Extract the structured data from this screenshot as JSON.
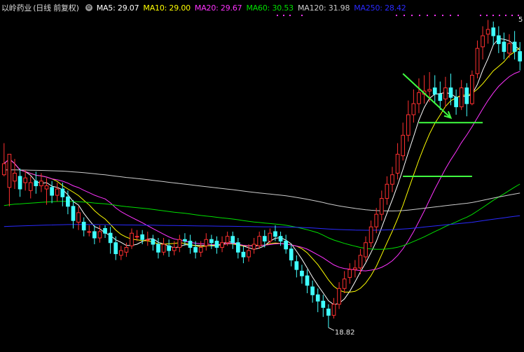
{
  "header": {
    "stock_name": "以岭药业",
    "period": "(日线 前复权)",
    "settings_icon": "settings-icon"
  },
  "ma_legend": [
    {
      "label": "MA5: 29.07",
      "color": "#ffffff"
    },
    {
      "label": "MA10: 29.00",
      "color": "#ffff00"
    },
    {
      "label": "MA20: 29.67",
      "color": "#ff33ff"
    },
    {
      "label": "MA60: 30.53",
      "color": "#00e000"
    },
    {
      "label": "MA120: 31.98",
      "color": "#cccccc"
    },
    {
      "label": "MA250: 28.42",
      "color": "#2a2aff"
    }
  ],
  "annotations": {
    "low_label": "18.82",
    "high_label": "5"
  },
  "chart_data": {
    "type": "candlestick",
    "title": "以岭药业 (日线 前复权)",
    "ylim": [
      17.5,
      38.5
    ],
    "low_value": 18.82,
    "grid": false,
    "up_color": "#ff3030",
    "down_color": "#40ffff",
    "candles": [
      [
        28.5,
        29.2,
        28.4,
        30.5
      ],
      [
        27.7,
        29.8,
        26.5,
        28.9
      ],
      [
        28.1,
        28.6,
        27.6,
        29.5
      ],
      [
        28.4,
        27.6,
        27.1,
        28.9
      ],
      [
        28.0,
        28.3,
        27.5,
        28.8
      ],
      [
        27.5,
        28.0,
        27.0,
        28.4
      ],
      [
        28.1,
        27.8,
        27.3,
        28.7
      ],
      [
        27.8,
        28.1,
        27.4,
        28.6
      ],
      [
        27.6,
        27.8,
        26.6,
        28.3
      ],
      [
        27.7,
        27.2,
        26.7,
        28.1
      ],
      [
        27.2,
        27.6,
        26.8,
        28.0
      ],
      [
        27.6,
        27.1,
        26.5,
        28.0
      ],
      [
        27.1,
        26.5,
        26.0,
        27.5
      ],
      [
        26.5,
        25.6,
        25.1,
        26.9
      ],
      [
        25.5,
        26.1,
        25.0,
        26.5
      ],
      [
        25.5,
        25.0,
        24.6,
        25.8
      ],
      [
        24.9,
        24.9,
        24.6,
        25.3
      ],
      [
        24.9,
        24.5,
        24.1,
        25.3
      ],
      [
        24.5,
        24.9,
        24.2,
        25.3
      ],
      [
        25.1,
        24.8,
        24.5,
        25.3
      ],
      [
        24.8,
        24.2,
        23.5,
        25.2
      ],
      [
        24.2,
        23.5,
        23.1,
        24.6
      ],
      [
        23.4,
        23.7,
        23.1,
        24.0
      ],
      [
        23.6,
        23.9,
        23.3,
        24.2
      ],
      [
        24.0,
        24.8,
        23.8,
        25.1
      ],
      [
        24.6,
        24.6,
        24.3,
        25.0
      ],
      [
        24.7,
        24.4,
        24.1,
        25.0
      ],
      [
        24.4,
        24.4,
        24.0,
        24.9
      ],
      [
        24.4,
        24.1,
        23.7,
        24.7
      ],
      [
        24.1,
        23.6,
        23.2,
        24.5
      ],
      [
        23.6,
        24.1,
        23.4,
        24.5
      ],
      [
        24.0,
        23.7,
        23.3,
        24.4
      ],
      [
        23.7,
        23.9,
        23.4,
        24.3
      ],
      [
        23.9,
        24.4,
        23.6,
        24.7
      ],
      [
        24.4,
        24.3,
        24.0,
        24.8
      ],
      [
        24.3,
        23.9,
        23.5,
        24.7
      ],
      [
        23.9,
        23.6,
        23.2,
        24.3
      ],
      [
        23.6,
        23.9,
        23.3,
        24.3
      ],
      [
        24.0,
        24.4,
        23.7,
        24.8
      ],
      [
        24.4,
        24.2,
        23.8,
        24.7
      ],
      [
        24.3,
        23.9,
        23.5,
        24.6
      ],
      [
        23.9,
        24.2,
        23.6,
        24.6
      ],
      [
        24.2,
        24.6,
        24.0,
        24.9
      ],
      [
        24.6,
        24.2,
        23.8,
        24.9
      ],
      [
        24.2,
        23.6,
        23.2,
        24.5
      ],
      [
        23.6,
        23.3,
        22.9,
        24.0
      ],
      [
        23.3,
        23.7,
        23.0,
        24.1
      ],
      [
        23.8,
        24.1,
        23.5,
        24.5
      ],
      [
        24.0,
        24.6,
        23.8,
        24.9
      ],
      [
        24.6,
        24.3,
        23.9,
        25.0
      ],
      [
        24.3,
        24.8,
        24.1,
        25.1
      ],
      [
        24.9,
        24.6,
        24.3,
        25.3
      ],
      [
        24.6,
        24.3,
        24.0,
        24.9
      ],
      [
        24.3,
        23.8,
        23.5,
        24.7
      ],
      [
        23.8,
        23.1,
        22.7,
        24.1
      ],
      [
        23.0,
        22.5,
        22.0,
        23.4
      ],
      [
        22.4,
        22.1,
        21.6,
        22.8
      ],
      [
        22.1,
        21.5,
        21.0,
        22.5
      ],
      [
        21.4,
        20.9,
        20.4,
        21.8
      ],
      [
        20.9,
        20.5,
        19.8,
        21.3
      ],
      [
        20.5,
        20.1,
        19.5,
        20.9
      ],
      [
        20.0,
        19.6,
        18.82,
        20.3
      ],
      [
        19.6,
        20.3,
        19.4,
        20.7
      ],
      [
        20.3,
        21.3,
        20.0,
        21.7
      ],
      [
        21.3,
        21.9,
        21.0,
        22.4
      ],
      [
        22.0,
        22.5,
        21.6,
        22.9
      ],
      [
        22.5,
        22.6,
        22.0,
        23.1
      ],
      [
        22.6,
        23.4,
        22.2,
        23.8
      ],
      [
        23.3,
        24.2,
        23.0,
        24.6
      ],
      [
        24.2,
        25.2,
        23.9,
        25.6
      ],
      [
        25.2,
        26.0,
        24.8,
        26.4
      ],
      [
        26.0,
        27.0,
        25.6,
        27.5
      ],
      [
        27.0,
        27.9,
        26.6,
        28.4
      ],
      [
        27.9,
        28.5,
        27.4,
        29.0
      ],
      [
        28.6,
        29.8,
        28.2,
        30.5
      ],
      [
        29.7,
        31.0,
        29.4,
        31.8
      ],
      [
        31.0,
        32.3,
        30.6,
        33.2
      ],
      [
        32.3,
        33.0,
        31.8,
        33.9
      ],
      [
        33.0,
        33.7,
        32.4,
        34.6
      ],
      [
        33.6,
        33.8,
        33.0,
        34.8
      ],
      [
        33.8,
        33.9,
        33.1,
        35.0
      ],
      [
        34.0,
        33.6,
        33.0,
        34.8
      ],
      [
        33.6,
        33.2,
        32.6,
        34.4
      ],
      [
        33.3,
        34.0,
        32.8,
        34.7
      ],
      [
        34.0,
        33.4,
        32.9,
        34.9
      ],
      [
        33.4,
        32.8,
        32.3,
        33.9
      ],
      [
        32.8,
        34.0,
        32.6,
        34.5
      ],
      [
        34.0,
        33.0,
        32.2,
        34.3
      ],
      [
        33.0,
        34.8,
        32.9,
        35.1
      ],
      [
        34.9,
        36.5,
        34.6,
        37.0
      ],
      [
        36.6,
        37.3,
        35.8,
        37.9
      ],
      [
        37.4,
        37.7,
        36.8,
        38.3
      ],
      [
        37.8,
        37.3,
        36.7,
        38.2
      ],
      [
        37.3,
        36.8,
        36.2,
        37.9
      ],
      [
        36.9,
        36.3,
        35.8,
        37.5
      ],
      [
        36.2,
        36.8,
        35.9,
        37.4
      ],
      [
        36.9,
        36.3,
        35.8,
        37.6
      ],
      [
        36.3,
        35.7,
        35.1,
        36.9
      ]
    ],
    "ma_series": [
      {
        "name": "MA5",
        "color": "#ffffff"
      },
      {
        "name": "MA10",
        "color": "#ffff00"
      },
      {
        "name": "MA20",
        "color": "#ff33ff"
      },
      {
        "name": "MA60",
        "color": "#00e000"
      },
      {
        "name": "MA120",
        "color": "#cccccc"
      },
      {
        "name": "MA250",
        "color": "#2a2aff"
      }
    ],
    "support_lines": [
      {
        "y": 31.8,
        "x_from": 78,
        "x_to": 90,
        "color": "#40ff40"
      },
      {
        "y": 28.4,
        "x_from": 75,
        "x_to": 88,
        "color": "#40ff40"
      }
    ],
    "arrow": {
      "from": [
        75,
        34.9
      ],
      "to": [
        84,
        32.1
      ],
      "color": "#40ff40"
    }
  }
}
